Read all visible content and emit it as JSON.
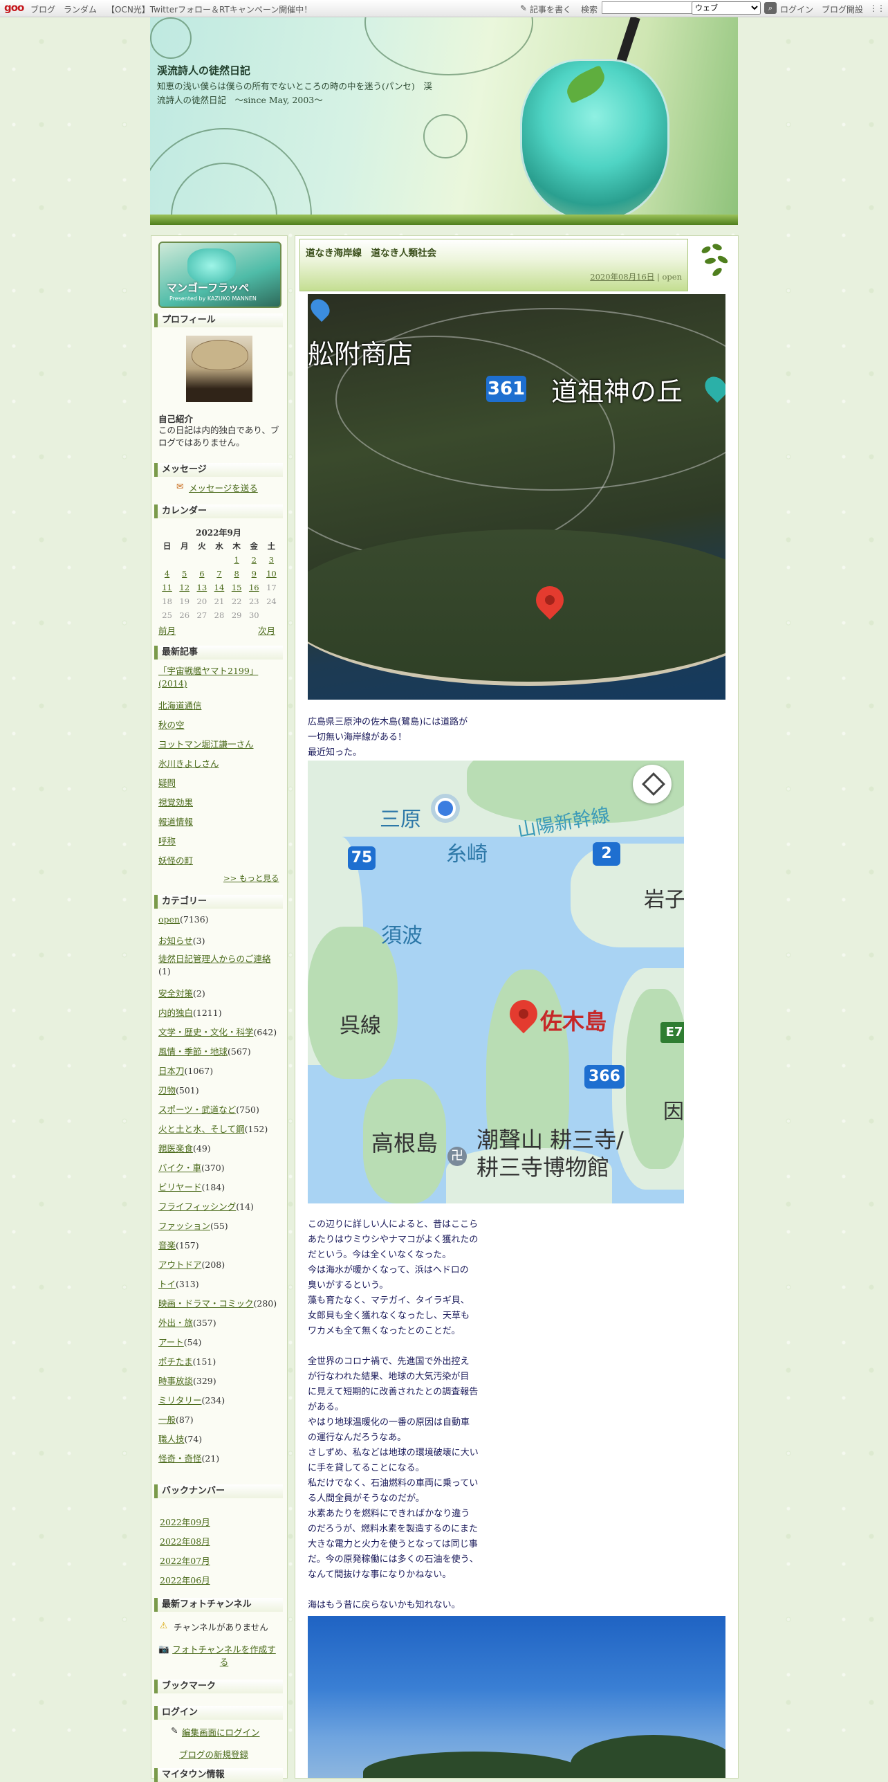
{
  "topbar": {
    "logo": "goo",
    "links": [
      "ブログ",
      "ランダム",
      "【OCN光】Twitterフォロー＆RTキャンペーン開催中！"
    ],
    "write": "記事を書く",
    "search_label": "検索",
    "search_value": "",
    "select_value": "ウェブ",
    "login": "ログイン",
    "open_blog": "ブログ開設"
  },
  "header": {
    "title": "渓流詩人の徒然日記",
    "desc": "知恵の浅い僕らは僕らの所有でないところの時の中を迷う(パンセ)　渓流詩人の徒然日記　～since May, 2003～"
  },
  "sidebar": {
    "banner_title": "マンゴーフラッペ",
    "banner_sub": "Presented by KAZUKO MANNEN",
    "profile": {
      "heading": "プロフィール",
      "self_label": "自己紹介",
      "self_text": "この日記は内的独白であり、ブログではありません。"
    },
    "message": {
      "heading": "メッセージ",
      "link": "メッセージを送る"
    },
    "calendar": {
      "heading": "カレンダー",
      "month": "2022年9月",
      "days": [
        "日",
        "月",
        "火",
        "水",
        "木",
        "金",
        "土"
      ],
      "weeks": [
        [
          "",
          "",
          "",
          "",
          "1",
          "2",
          "3"
        ],
        [
          "4",
          "5",
          "6",
          "7",
          "8",
          "9",
          "10"
        ],
        [
          "11",
          "12",
          "13",
          "14",
          "15",
          "16",
          "17"
        ],
        [
          "18",
          "19",
          "20",
          "21",
          "22",
          "23",
          "24"
        ],
        [
          "25",
          "26",
          "27",
          "28",
          "29",
          "30",
          ""
        ]
      ],
      "prev": "前月",
      "next": "次月"
    },
    "recent": {
      "heading": "最新記事",
      "items": [
        "「宇宙戦艦ヤマト2199」(2014)",
        "北海道通信",
        "秋の空",
        "ヨットマン堀江謙一さん",
        "氷川きよしさん",
        "疑問",
        "視覚効果",
        "報道情報",
        "呼称",
        "妖怪の町"
      ],
      "more": ">> もっと見る"
    },
    "categories": {
      "heading": "カテゴリー",
      "items": [
        {
          "name": "open",
          "count": "(7136)"
        },
        {
          "name": "お知らせ",
          "count": "(3)"
        },
        {
          "name": "徒然日記管理人からのご連絡",
          "count": "(1)"
        },
        {
          "name": "安全対策",
          "count": "(2)"
        },
        {
          "name": "内的独白",
          "count": "(1211)"
        },
        {
          "name": "文学・歴史・文化・科学",
          "count": "(642)"
        },
        {
          "name": "風情・季節・地球",
          "count": "(567)"
        },
        {
          "name": "日本刀",
          "count": "(1067)"
        },
        {
          "name": "刃物",
          "count": "(501)"
        },
        {
          "name": "スポーツ・武道など",
          "count": "(750)"
        },
        {
          "name": "火と土と水、そして鋼",
          "count": "(152)"
        },
        {
          "name": "親医楽食",
          "count": "(49)"
        },
        {
          "name": "バイク・車",
          "count": "(370)"
        },
        {
          "name": "ビリヤード",
          "count": "(184)"
        },
        {
          "name": "フライフィッシング",
          "count": "(14)"
        },
        {
          "name": "ファッション",
          "count": "(55)"
        },
        {
          "name": "音楽",
          "count": "(157)"
        },
        {
          "name": "アウトドア",
          "count": "(208)"
        },
        {
          "name": "トイ",
          "count": "(313)"
        },
        {
          "name": "映画・ドラマ・コミック",
          "count": "(280)"
        },
        {
          "name": "外出・旅",
          "count": "(357)"
        },
        {
          "name": "アート",
          "count": "(54)"
        },
        {
          "name": "ポチたま",
          "count": "(151)"
        },
        {
          "name": "時事放談",
          "count": "(329)"
        },
        {
          "name": "ミリタリー",
          "count": "(234)"
        },
        {
          "name": "一般",
          "count": "(87)"
        },
        {
          "name": "職人技",
          "count": "(74)"
        },
        {
          "name": "怪奇・奇怪",
          "count": "(21)"
        }
      ]
    },
    "backnumber": {
      "heading": "バックナンバー",
      "items": [
        "2022年09月",
        "2022年08月",
        "2022年07月",
        "2022年06月"
      ]
    },
    "photo": {
      "heading": "最新フォトチャンネル",
      "none": "チャンネルがありません",
      "create": "フォトチャンネルを作成する"
    },
    "bookmark": {
      "heading": "ブックマーク"
    },
    "login": {
      "heading": "ログイン",
      "edit": "編集画面にログイン",
      "register": "ブログの新規登録"
    },
    "last_heading": "マイタウン情報"
  },
  "post": {
    "title": "道なき海岸線　道なき人類社会",
    "date": "2020年08月16日",
    "sep": " | ",
    "category": "open",
    "satmap": {
      "label1": "舩附商店",
      "label2": "道祖神の丘",
      "route": "361"
    },
    "para1": "広島県三原沖の佐木島(鷺島)には道路が\n一切無い海岸線がある！\n最近知った。",
    "stdmap": {
      "mihara": "三原",
      "itozaki": "糸崎",
      "sanyo": "山陽新幹線",
      "suba": "須波",
      "kure": "呉線",
      "sagi": "佐木島",
      "takane": "高根島",
      "temple": "潮聲山 耕三寺/\n耕三寺博物館",
      "iwako": "岩子",
      "in": "因",
      "r75": "75",
      "r2": "2",
      "r366": "366",
      "e7": "E7"
    },
    "para2": "この辺りに詳しい人によると、昔はここら\nあたりはウミウシやナマコがよく獲れたの\nだという。今は全くいなくなった。\n今は海水が暖かくなって、浜はヘドロの\n臭いがするという。\n藻も育たなく、マテガイ、タイラギ貝、\n女郎貝も全く獲れなくなったし、天草も\nワカメも全て無くなったとのことだ。\n\n全世界のコロナ禍で、先進国で外出控え\nが行なわれた結果、地球の大気汚染が目\nに見えて短期的に改善されたとの調査報告\nがある。\nやはり地球温暖化の一番の原因は自動車\nの運行なんだろうなあ。\nさしずめ、私などは地球の環境破壊に大い\nに手を貸してることになる。\n私だけでなく、石油燃料の車両に乗ってい\nる人間全員がそうなのだが。\n水素あたりを燃料にできればかなり違う\nのだろうが、燃料水素を製造するのにまた\n大きな電力と火力を使うとなっては同じ事\nだ。今の原発稼働には多くの石油を使う、\nなんて間抜けな事になりかねない。",
    "para3": "海はもう昔に戻らないかも知れない。"
  }
}
